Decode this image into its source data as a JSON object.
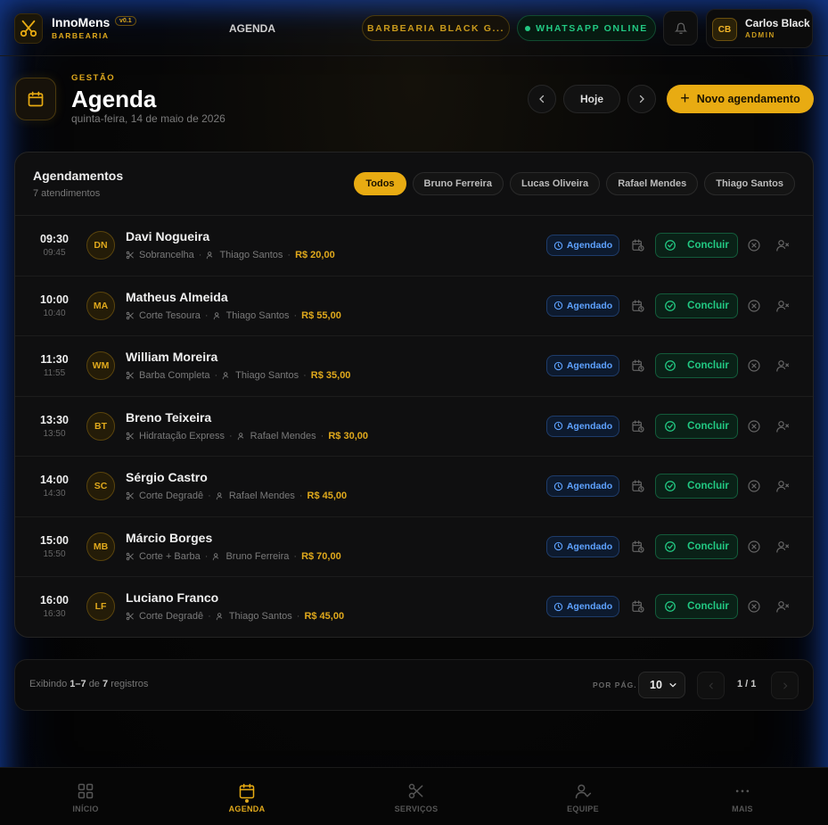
{
  "app": {
    "name": "InnoMens",
    "version": "v0.1",
    "subtitle": "BARBEARIA",
    "section": "AGENDA",
    "shop": "BARBEARIA BLACK G...",
    "whatsapp": "WHATSAPP ONLINE",
    "user": {
      "initials": "CB",
      "name": "Carlos Black",
      "role": "ADMIN"
    }
  },
  "header": {
    "kicker": "GESTÃO",
    "title": "Agenda",
    "date": "quinta-feira, 14 de maio de 2026",
    "today": "Hoje",
    "new": "Novo agendamento"
  },
  "card": {
    "title": "Agendamentos",
    "subtitle": "7 atendimentos",
    "filters": [
      "Todos",
      "Bruno Ferreira",
      "Lucas Oliveira",
      "Rafael Mendes",
      "Thiago Santos"
    ],
    "status_label": "Agendado",
    "done_label": "Concluir"
  },
  "appointments": [
    {
      "start": "09:30",
      "end": "09:45",
      "initials": "DN",
      "name": "Davi Nogueira",
      "service": "Sobrancelha",
      "barber": "Thiago Santos",
      "price": "R$ 20,00"
    },
    {
      "start": "10:00",
      "end": "10:40",
      "initials": "MA",
      "name": "Matheus Almeida",
      "service": "Corte Tesoura",
      "barber": "Thiago Santos",
      "price": "R$ 55,00"
    },
    {
      "start": "11:30",
      "end": "11:55",
      "initials": "WM",
      "name": "William Moreira",
      "service": "Barba Completa",
      "barber": "Thiago Santos",
      "price": "R$ 35,00"
    },
    {
      "start": "13:30",
      "end": "13:50",
      "initials": "BT",
      "name": "Breno Teixeira",
      "service": "Hidratação Express",
      "barber": "Rafael Mendes",
      "price": "R$ 30,00"
    },
    {
      "start": "14:00",
      "end": "14:30",
      "initials": "SC",
      "name": "Sérgio Castro",
      "service": "Corte Degradê",
      "barber": "Rafael Mendes",
      "price": "R$ 45,00"
    },
    {
      "start": "15:00",
      "end": "15:50",
      "initials": "MB",
      "name": "Márcio Borges",
      "service": "Corte + Barba",
      "barber": "Bruno Ferreira",
      "price": "R$ 70,00"
    },
    {
      "start": "16:00",
      "end": "16:30",
      "initials": "LF",
      "name": "Luciano Franco",
      "service": "Corte Degradê",
      "barber": "Thiago Santos",
      "price": "R$ 45,00"
    }
  ],
  "pagination": {
    "showing": "Exibindo",
    "range": "1–7",
    "of": "de",
    "total": "7",
    "records": "registros",
    "per_page_label": "POR PÁG.",
    "per_page": "10",
    "page": "1 / 1"
  },
  "bottom_nav": [
    {
      "label": "INÍCIO",
      "icon": "grid-icon"
    },
    {
      "label": "AGENDA",
      "icon": "calendar-icon"
    },
    {
      "label": "SERVIÇOS",
      "icon": "scissors-icon"
    },
    {
      "label": "EQUIPE",
      "icon": "team-icon"
    },
    {
      "label": "MAIS",
      "icon": "more-icon"
    }
  ],
  "colors": {
    "accent": "#e8ab12",
    "success": "#22c983",
    "info": "#5ea2ff"
  }
}
